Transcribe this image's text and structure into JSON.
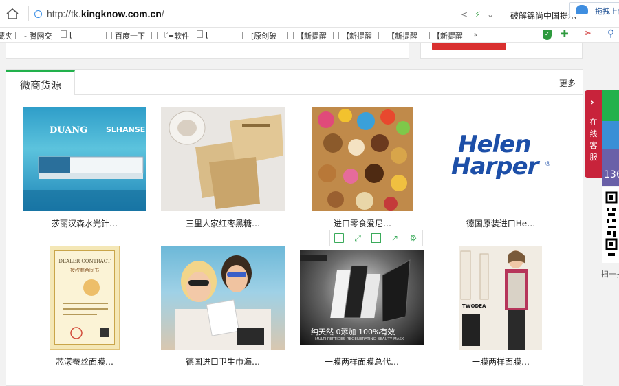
{
  "browser": {
    "url_prefix": "http://tk.",
    "url_domain": "kingknow.com.cn",
    "url_suffix": "/",
    "tab_title": "破解锦尚中国提示",
    "upload_label": "拖拽上传"
  },
  "bookmarks": [
    {
      "label": "藏夹"
    },
    {
      "label": "- 腾网交"
    },
    {
      "label": "["
    },
    {
      "label": "百度一下"
    },
    {
      "label": "『=软件"
    },
    {
      "label": "["
    },
    {
      "label": "[原创破"
    },
    {
      "label": "【新提醒"
    },
    {
      "label": "【新提醒"
    },
    {
      "label": "【新提醒"
    },
    {
      "label": "【新提醒"
    },
    {
      "label": "»"
    }
  ],
  "section": {
    "tab_label": "微商货源",
    "more_label": "更多"
  },
  "products": [
    {
      "caption": "莎丽汉森水光针…",
      "brand_text": "SLHANSEN",
      "banner_text": "DUANG",
      "image": "blue-ocean-cosmetic"
    },
    {
      "caption": "三里人家红枣黑糖…",
      "image": "tea-packets"
    },
    {
      "caption": "进口零食爱尼…",
      "image": "candy-pile"
    },
    {
      "caption": "德国原装进口He…",
      "brand_line1": "Helen",
      "brand_line2": "Harper",
      "image": "helen-harper-logo"
    },
    {
      "caption": "芯漾蚕丝面膜…",
      "cert_title": "DEALER CONTRACT",
      "cert_sub": "授权商合同书",
      "image": "dealer-certificate"
    },
    {
      "caption": "德国进口卫生巾海…",
      "image": "two-women-photo"
    },
    {
      "caption": "一膜两样面膜总代…",
      "promo_text": "纯天然 0添加 100%有效",
      "promo_sub": "MULTI PEPTIDES REGENERATING BEAUTY MASK",
      "image": "black-mask-promo"
    },
    {
      "caption": "一膜两样面膜…",
      "brand_text": "TWODEA",
      "image": "fashion-woman-ad"
    }
  ],
  "sidebar": {
    "arrow": "›",
    "service_text": "在线客服",
    "phone_fragment": "136",
    "scan_label": "扫一扫"
  },
  "colors": {
    "accent_green": "#22b14c",
    "sidebar_red": "#c8233b",
    "sidebar_blue": "#3a8fd6",
    "sidebar_purple": "#6a60a8"
  }
}
